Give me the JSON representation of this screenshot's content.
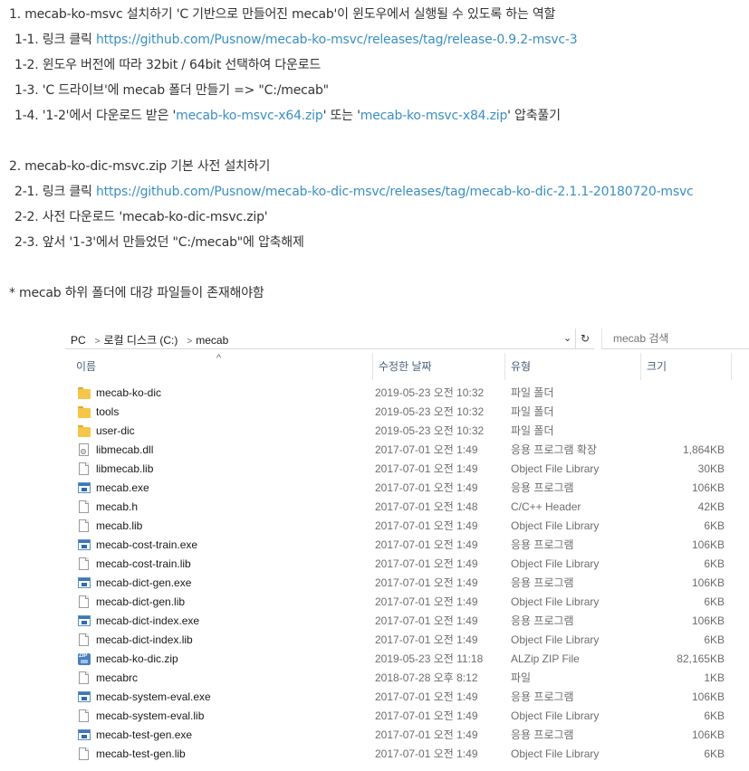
{
  "doc": {
    "section1_title": "1.  mecab-ko-msvc 설치하기 'C 기반으로 만들어진 mecab'이 윈도우에서 실행될 수 있도록 하는 역할",
    "s1_1_prefix": "1-1. 링크 클릭 ",
    "s1_1_link": "https://github.com/Pusnow/mecab-ko-msvc/releases/tag/release-0.9.2-msvc-3",
    "s1_2": "1-2. 윈도우 버전에 따라 32bit /  64bit 선택하여 다운로드",
    "s1_3": "1-3. 'C 드라이브'에 mecab 폴더 만들기 => \"C:/mecab\"",
    "s1_4_prefix": "1-4. '1-2'에서 다운로드 받은 '",
    "s1_4_link1": "mecab-ko-msvc-x64.zip",
    "s1_4_mid": "' 또는 '",
    "s1_4_link2": "mecab-ko-msvc-x84.zip",
    "s1_4_suffix": "' 압축풀기",
    "section2_title": "2. mecab-ko-dic-msvc.zip 기본 사전 설치하기",
    "s2_1_prefix": "2-1. 링크 클릭 ",
    "s2_1_link": "https://github.com/Pusnow/mecab-ko-dic-msvc/releases/tag/mecab-ko-dic-2.1.1-20180720-msvc",
    "s2_2": "2-2. 사전 다운로드 'mecab-ko-dic-msvc.zip'",
    "s2_3": "2-3. 앞서 '1-3'에서 만들었던  \"C:/mecab\"에 압축해제",
    "note": "* mecab 하위 폴더에 대강 파일들이 존재해야함"
  },
  "explorer": {
    "breadcrumb": [
      "PC",
      "로컬 디스크 (C:)",
      "mecab"
    ],
    "search_placeholder": "mecab 검색",
    "columns": {
      "name": "이름",
      "date": "수정한 날짜",
      "type": "유형",
      "size": "크기"
    },
    "files": [
      {
        "name": "mecab-ko-dic",
        "date": "2019-05-23 오전 10:32",
        "type": "파일 폴더",
        "size": "",
        "icon": "folder"
      },
      {
        "name": "tools",
        "date": "2019-05-23 오전 10:32",
        "type": "파일 폴더",
        "size": "",
        "icon": "folder"
      },
      {
        "name": "user-dic",
        "date": "2019-05-23 오전 10:32",
        "type": "파일 폴더",
        "size": "",
        "icon": "folder"
      },
      {
        "name": "libmecab.dll",
        "date": "2017-07-01 오전 1:49",
        "type": "응용 프로그램 확장",
        "size": "1,864KB",
        "icon": "dll"
      },
      {
        "name": "libmecab.lib",
        "date": "2017-07-01 오전 1:49",
        "type": "Object File Library",
        "size": "30KB",
        "icon": "file"
      },
      {
        "name": "mecab.exe",
        "date": "2017-07-01 오전 1:49",
        "type": "응용 프로그램",
        "size": "106KB",
        "icon": "exe"
      },
      {
        "name": "mecab.h",
        "date": "2017-07-01 오전 1:48",
        "type": "C/C++ Header",
        "size": "42KB",
        "icon": "file"
      },
      {
        "name": "mecab.lib",
        "date": "2017-07-01 오전 1:49",
        "type": "Object File Library",
        "size": "6KB",
        "icon": "file"
      },
      {
        "name": "mecab-cost-train.exe",
        "date": "2017-07-01 오전 1:49",
        "type": "응용 프로그램",
        "size": "106KB",
        "icon": "exe"
      },
      {
        "name": "mecab-cost-train.lib",
        "date": "2017-07-01 오전 1:49",
        "type": "Object File Library",
        "size": "6KB",
        "icon": "file"
      },
      {
        "name": "mecab-dict-gen.exe",
        "date": "2017-07-01 오전 1:49",
        "type": "응용 프로그램",
        "size": "106KB",
        "icon": "exe"
      },
      {
        "name": "mecab-dict-gen.lib",
        "date": "2017-07-01 오전 1:49",
        "type": "Object File Library",
        "size": "6KB",
        "icon": "file"
      },
      {
        "name": "mecab-dict-index.exe",
        "date": "2017-07-01 오전 1:49",
        "type": "응용 프로그램",
        "size": "106KB",
        "icon": "exe"
      },
      {
        "name": "mecab-dict-index.lib",
        "date": "2017-07-01 오전 1:49",
        "type": "Object File Library",
        "size": "6KB",
        "icon": "file"
      },
      {
        "name": "mecab-ko-dic.zip",
        "date": "2019-05-23 오전 11:18",
        "type": "ALZip ZIP File",
        "size": "82,165KB",
        "icon": "zip"
      },
      {
        "name": "mecabrc",
        "date": "2018-07-28 오후 8:12",
        "type": "파일",
        "size": "1KB",
        "icon": "file"
      },
      {
        "name": "mecab-system-eval.exe",
        "date": "2017-07-01 오전 1:49",
        "type": "응용 프로그램",
        "size": "106KB",
        "icon": "exe"
      },
      {
        "name": "mecab-system-eval.lib",
        "date": "2017-07-01 오전 1:49",
        "type": "Object File Library",
        "size": "6KB",
        "icon": "file"
      },
      {
        "name": "mecab-test-gen.exe",
        "date": "2017-07-01 오전 1:49",
        "type": "응용 프로그램",
        "size": "106KB",
        "icon": "exe"
      },
      {
        "name": "mecab-test-gen.lib",
        "date": "2017-07-01 오전 1:49",
        "type": "Object File Library",
        "size": "6KB",
        "icon": "file"
      }
    ]
  }
}
